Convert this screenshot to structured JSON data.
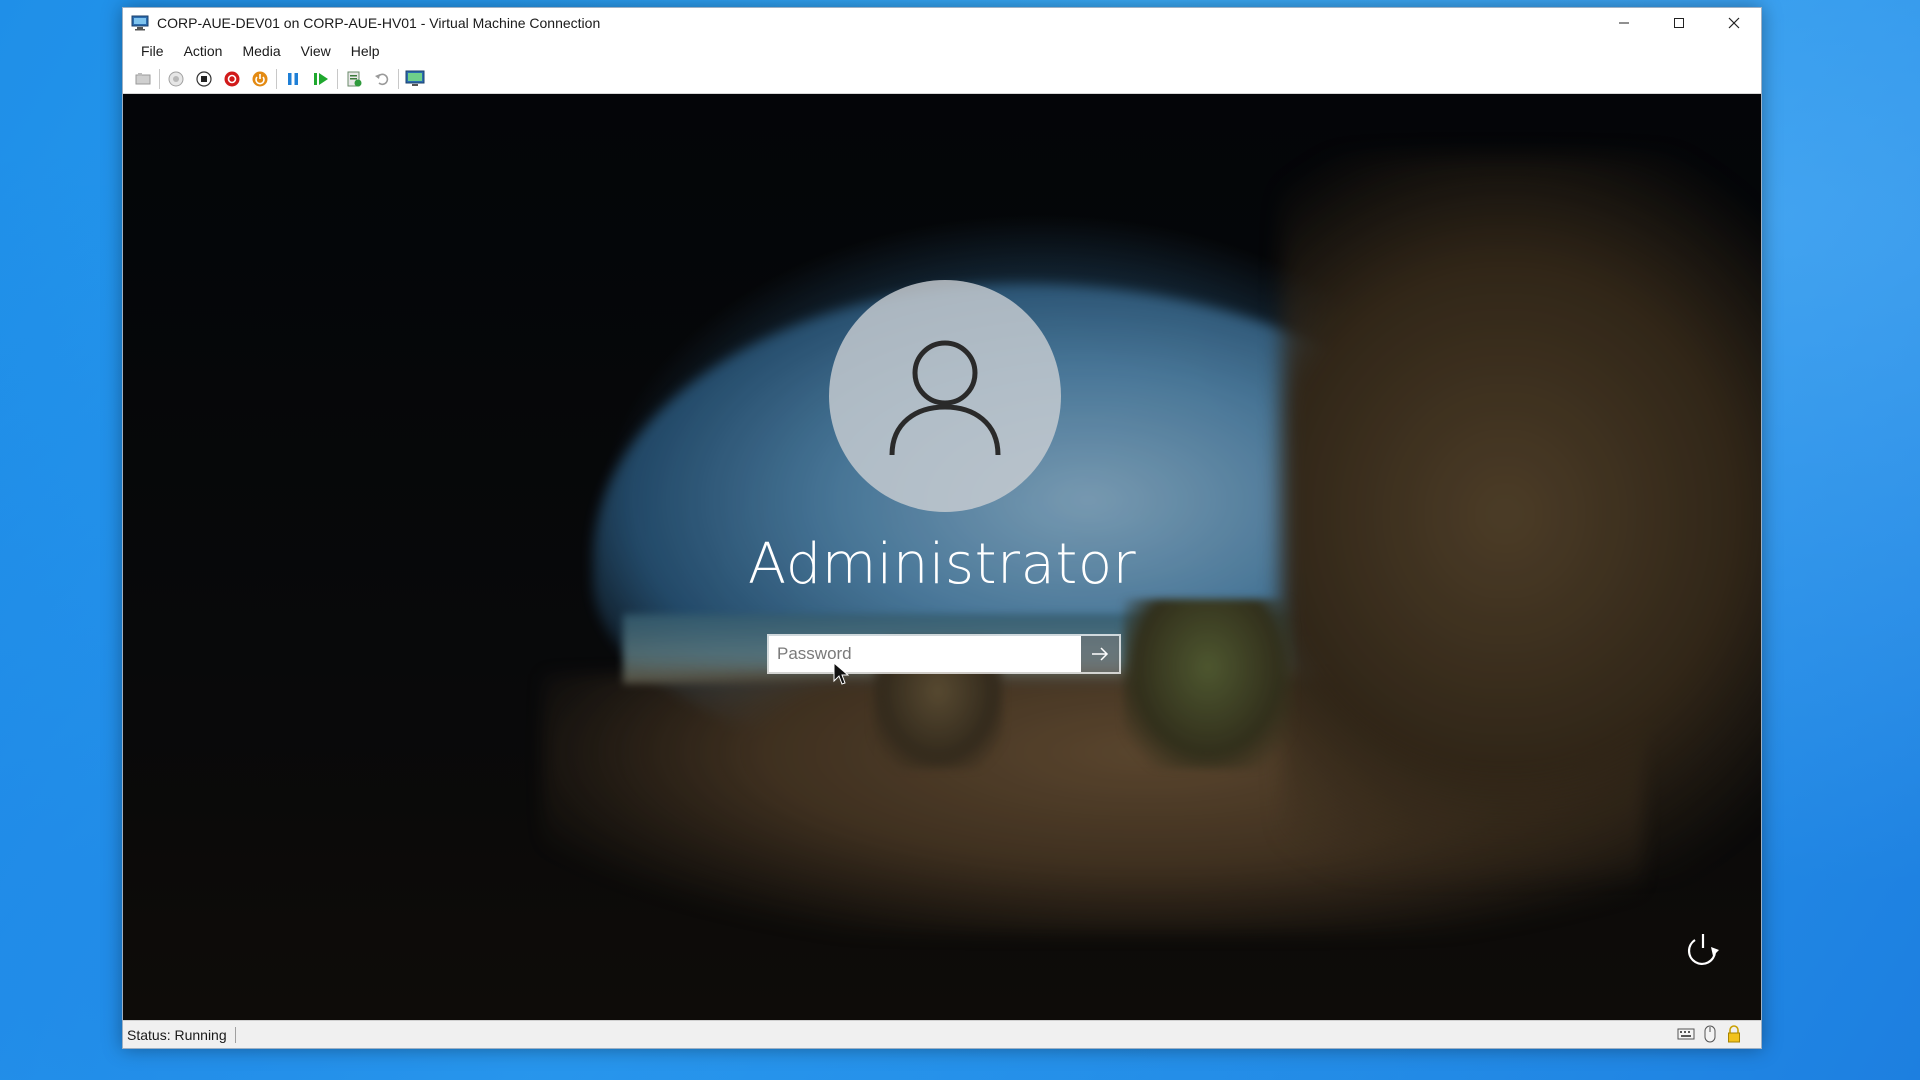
{
  "window": {
    "title": "CORP-AUE-DEV01 on CORP-AUE-HV01 - Virtual Machine Connection"
  },
  "menu": {
    "items": [
      "File",
      "Action",
      "Media",
      "View",
      "Help"
    ]
  },
  "toolbar": {
    "buttons": [
      {
        "icon": "ctrl-alt-del-icon"
      },
      {
        "icon": "start-icon"
      },
      {
        "icon": "turn-off-icon"
      },
      {
        "icon": "shutdown-icon"
      },
      {
        "icon": "save-state-icon"
      },
      {
        "icon": "pause-icon"
      },
      {
        "icon": "resume-icon"
      },
      {
        "icon": "checkpoint-icon"
      },
      {
        "icon": "revert-icon"
      },
      {
        "icon": "enhanced-session-icon"
      }
    ],
    "colors": {
      "shutdown": "#d11a1a",
      "save": "#e38a12",
      "pause": "#1f7fd6",
      "resume": "#1fa82e"
    }
  },
  "login": {
    "username": "Administrator",
    "password_placeholder": "Password",
    "password_value": ""
  },
  "status": {
    "text": "Status: Running"
  },
  "status_icons": [
    "keyboard-icon",
    "mouse-icon",
    "lock-icon"
  ]
}
